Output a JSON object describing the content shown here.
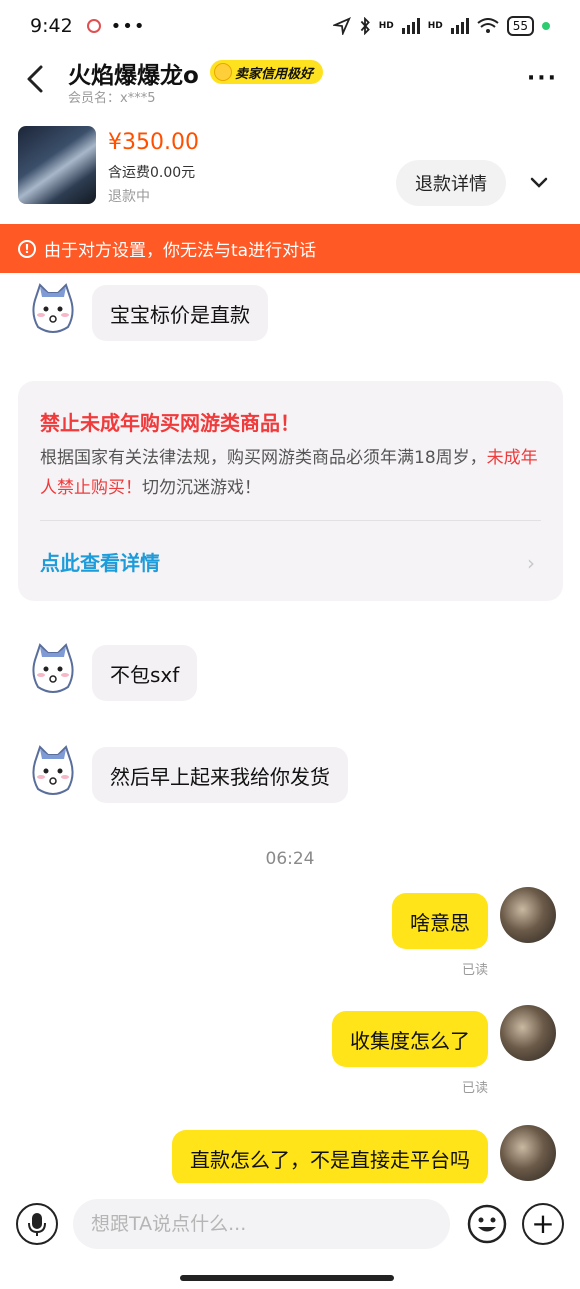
{
  "status_bar": {
    "time": "9:42",
    "more": "•••",
    "network_1": "HD",
    "network_2": "HD",
    "battery": "55"
  },
  "header": {
    "seller_name": "火焰爆爆龙o",
    "credit_badge": "卖家信用极好",
    "member_label": "会员名：x***5",
    "more_icon": "more-horizontal-icon"
  },
  "product": {
    "price": "¥350.00",
    "shipping": "含运费0.00元",
    "status": "退款中",
    "refund_detail_button": "退款详情"
  },
  "warning": {
    "text": "由于对方设置，你无法与ta进行对话",
    "color": "#ff5a26"
  },
  "messages": [
    {
      "side": "left",
      "text": "宝宝标价是直款"
    },
    {
      "side": "left",
      "text": "不包sxf"
    },
    {
      "side": "left",
      "text": "然后早上起来我给你发货"
    },
    {
      "side": "right",
      "text": "啥意思",
      "read": "已读"
    },
    {
      "side": "right",
      "text": "收集度怎么了",
      "read": "已读"
    },
    {
      "side": "right",
      "text": "直款怎么了，不是直接走平台吗"
    }
  ],
  "notice_card": {
    "title": "禁止未成年购买网游类商品！",
    "body_start": "根据国家有关法律法规，购买网游类商品必须年满18周岁，",
    "body_highlight": "未成年人禁止购买！",
    "body_end": "切勿沉迷游戏！",
    "link": "点此查看详情"
  },
  "timestamp": "06:24",
  "input_bar": {
    "placeholder": "想跟TA说点什么..."
  },
  "colors": {
    "accent_yellow": "#ffe419",
    "price_orange": "#ff5000",
    "link_blue": "#1e9bd9",
    "warning_red": "#ef3b3b"
  }
}
